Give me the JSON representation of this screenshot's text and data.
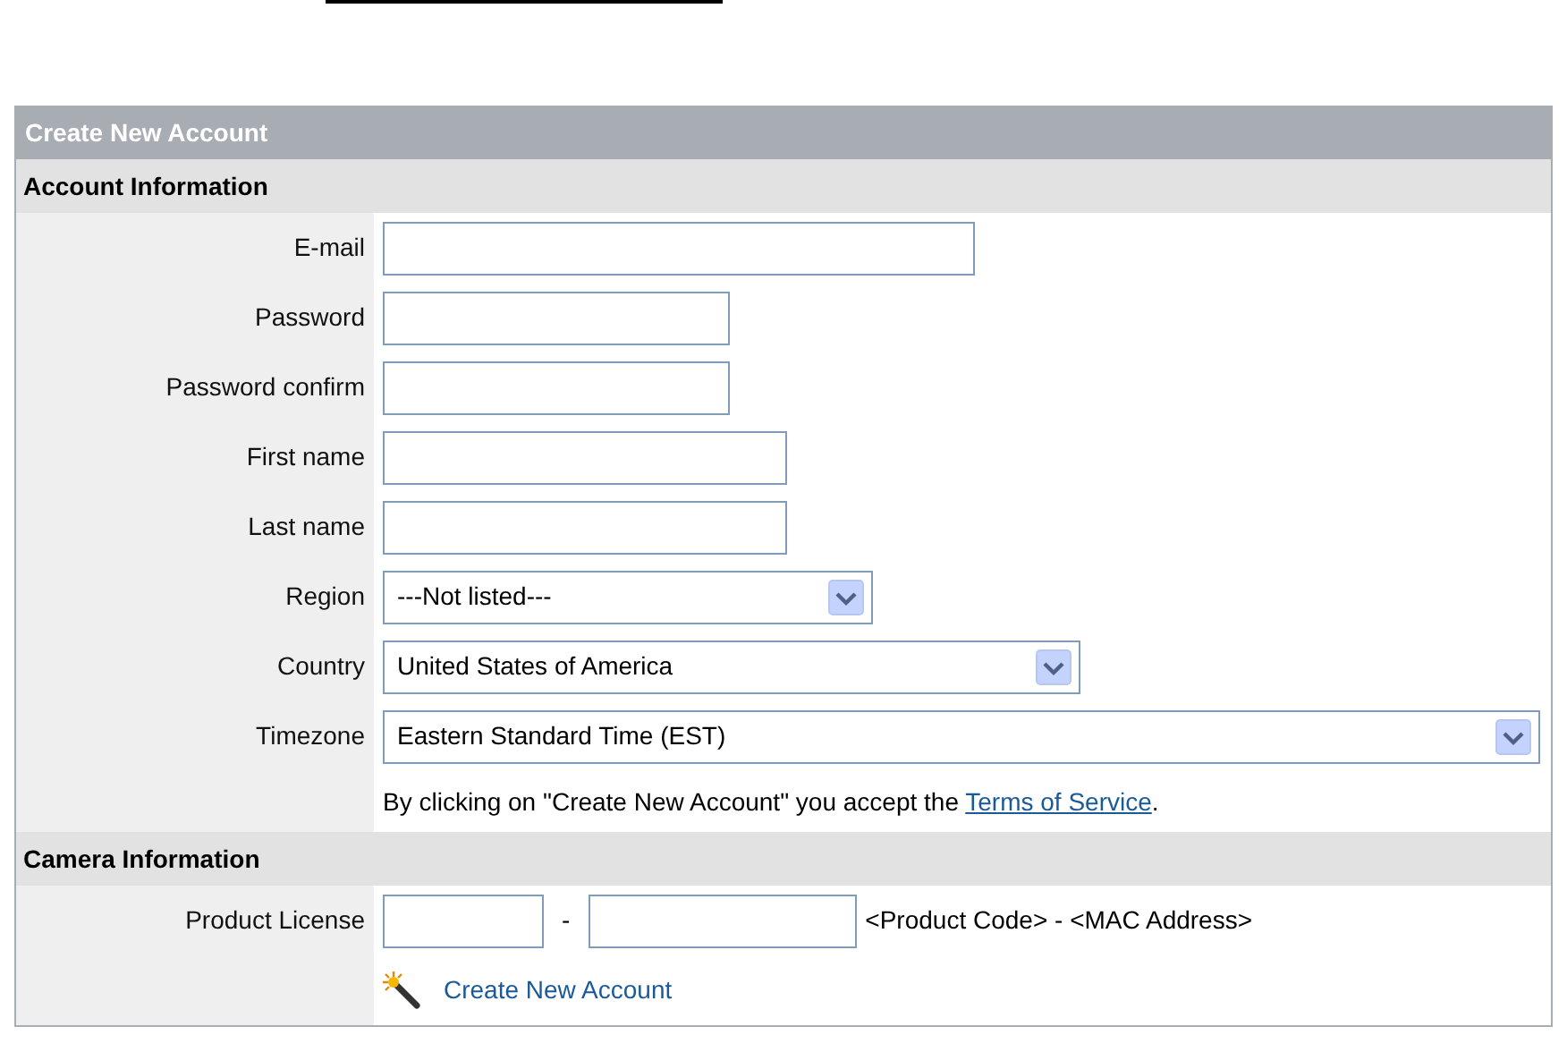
{
  "panel": {
    "title": "Create New Account"
  },
  "account_section": {
    "heading": "Account Information",
    "fields": [
      {
        "label": "E-mail",
        "kind": "text"
      },
      {
        "label": "Password",
        "kind": "text"
      },
      {
        "label": "Password confirm",
        "kind": "text"
      },
      {
        "label": "First name",
        "kind": "text"
      },
      {
        "label": "Last name",
        "kind": "text"
      },
      {
        "label": "Region",
        "kind": "select",
        "value": "---Not listed---"
      },
      {
        "label": "Country",
        "kind": "select",
        "value": "United States of America"
      },
      {
        "label": "Timezone",
        "kind": "select",
        "value": "Eastern Standard Time (EST)"
      }
    ],
    "terms_text": "By clicking on \"Create New Account\" you accept the",
    "terms_link": "Terms of Service",
    "terms_end": "."
  },
  "camera_section": {
    "heading": "Camera Information",
    "license_label": "Product License",
    "separator": "-",
    "hint": "<Product Code> - <MAC Address>"
  },
  "submit": {
    "label": "Create New Account"
  }
}
